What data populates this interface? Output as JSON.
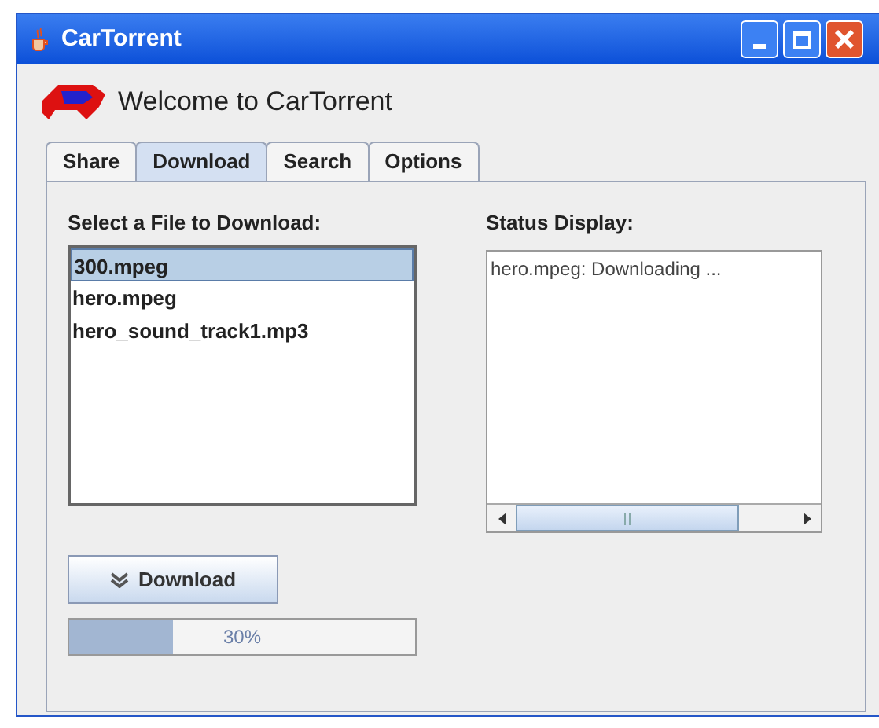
{
  "window": {
    "title": "CarTorrent"
  },
  "header": {
    "title": "Welcome to CarTorrent"
  },
  "tabs": [
    {
      "label": "Share",
      "selected": false
    },
    {
      "label": "Download",
      "selected": true
    },
    {
      "label": "Search",
      "selected": false
    },
    {
      "label": "Options",
      "selected": false
    }
  ],
  "file_list": {
    "label": "Select a File to Download:",
    "items": [
      {
        "name": "300.mpeg",
        "selected": true
      },
      {
        "name": "hero.mpeg",
        "selected": false
      },
      {
        "name": "hero_sound_track1.mp3",
        "selected": false
      }
    ]
  },
  "download_button": {
    "label": "Download"
  },
  "progress": {
    "level": 0.3,
    "reading": "30%"
  },
  "status": {
    "label": "Status Display:",
    "lines": [
      "hero.mpeg: Downloading ..."
    ]
  }
}
